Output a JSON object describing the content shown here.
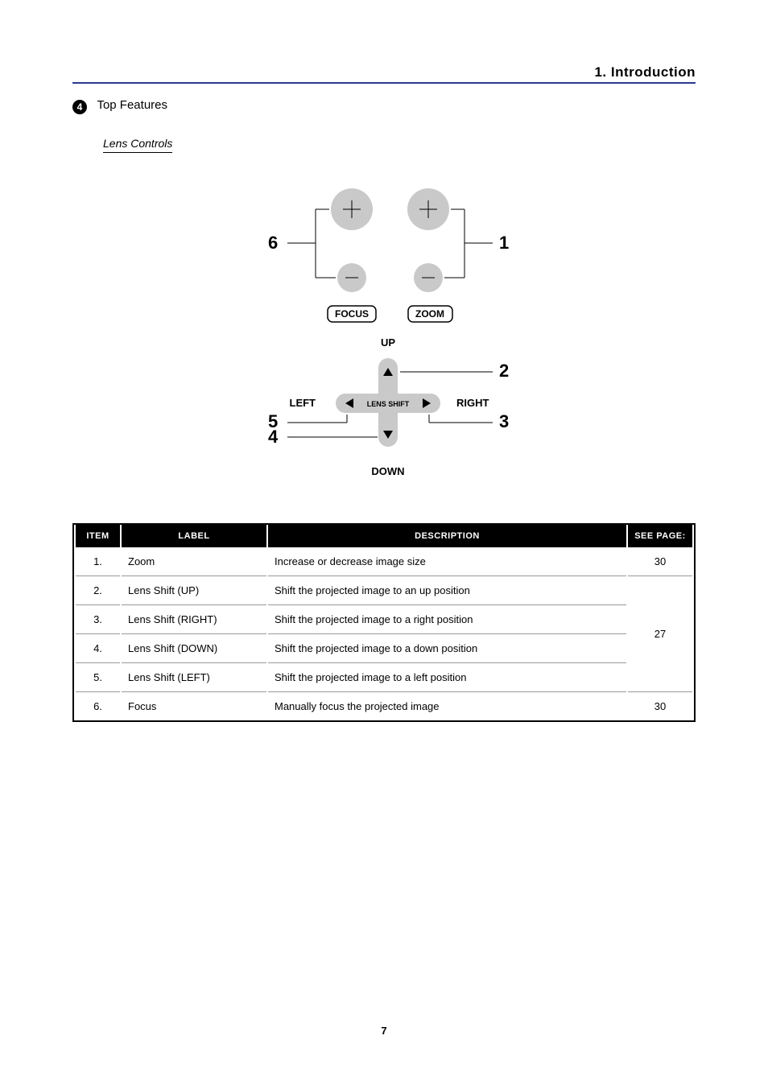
{
  "header": "1. Introduction",
  "section_number": "4",
  "section_title": "Top Features",
  "subsection_title": "Lens Controls",
  "diagram": {
    "focus_label": "FOCUS",
    "zoom_label": "ZOOM",
    "up": "UP",
    "down": "DOWN",
    "left": "LEFT",
    "right": "RIGHT",
    "lens_shift": "LENS SHIFT",
    "num1": "1",
    "num2": "2",
    "num3": "3",
    "num4": "4",
    "num5": "5",
    "num6": "6"
  },
  "table": {
    "headers": {
      "item": "ITEM",
      "label": "LABEL",
      "description": "DESCRIPTION",
      "see_page": "SEE PAGE:"
    },
    "rows": [
      {
        "item": "1.",
        "label": "Zoom",
        "desc": "Increase or decrease image size",
        "page": "30"
      },
      {
        "item": "2.",
        "label": "Lens Shift (UP)",
        "desc": "Shift the projected image to an up position",
        "page": "27"
      },
      {
        "item": "3.",
        "label": "Lens Shift (RIGHT)",
        "desc": "Shift the projected image to a right position",
        "page": "27"
      },
      {
        "item": "4.",
        "label": "Lens Shift (DOWN)",
        "desc": "Shift the projected image to a down position",
        "page": "27"
      },
      {
        "item": "5.",
        "label": "Lens Shift (LEFT)",
        "desc": "Shift the projected image to a left position",
        "page": "27"
      },
      {
        "item": "6.",
        "label": "Focus",
        "desc": "Manually focus the projected image",
        "page": "30"
      }
    ]
  },
  "page_number": "7"
}
